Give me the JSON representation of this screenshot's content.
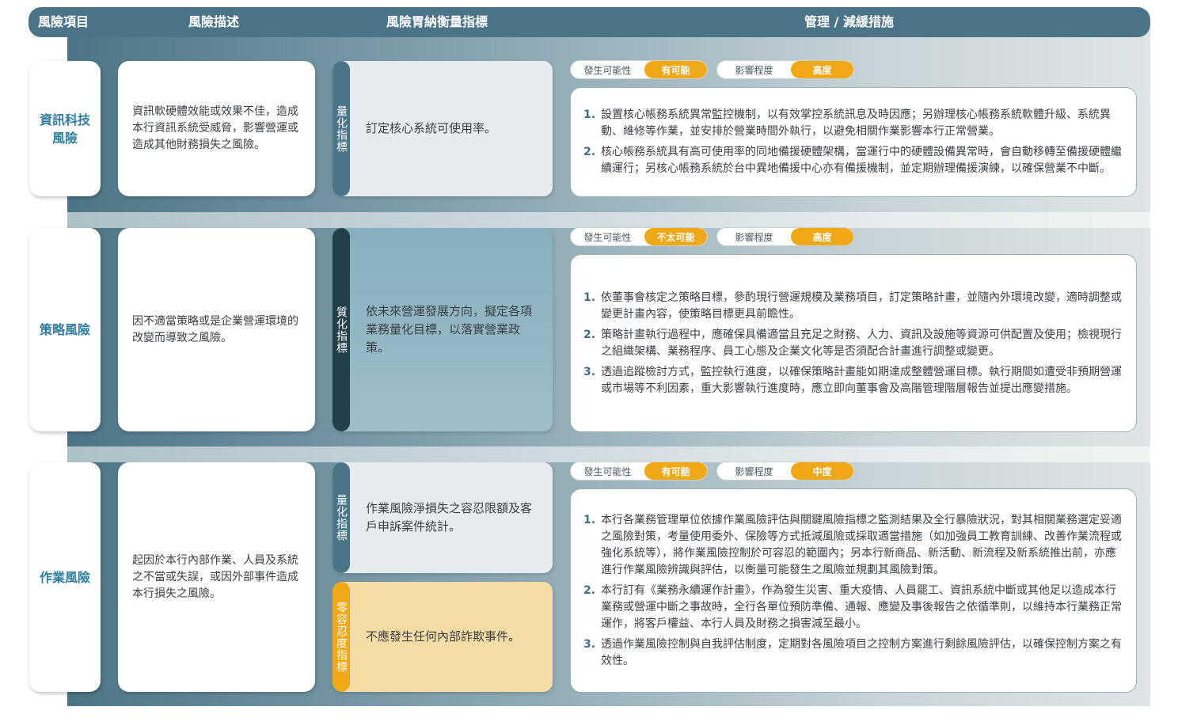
{
  "header": {
    "col1": "風險項目",
    "col2": "風險描述",
    "col3": "風險胃納衡量指標",
    "col4": "管理 / 減緩措施"
  },
  "rows": [
    {
      "category": "資訊科技\n風險",
      "description": "資訊軟硬體效能或效果不佳，造成本行資訊系統受威脅，影響營運或造成其他財務損失之風險。",
      "indicators": [
        {
          "tag": "量化指標",
          "text": "訂定核心系統可使用率。"
        }
      ],
      "likelihood_label": "發生可能性",
      "likelihood": "有可能",
      "impact_label": "影響程度",
      "impact": "高度",
      "measures": [
        {
          "num": "1.",
          "text": "設置核心帳務系統異常監控機制，以有效掌控系統訊息及時因應；另辦理核心帳務系統軟體升級、系統異動、維修等作業，並安排於營業時間外執行，以避免相關作業影響本行正常營業。"
        },
        {
          "num": "2.",
          "text": "核心帳務系統具有高可使用率的同地備援硬體架構，當運行中的硬體設備異常時，會自動移轉至備援硬體繼續運行；另核心帳務系統於台中異地備援中心亦有備援機制，並定期辦理備援演練，以確保營業不中斷。"
        }
      ]
    },
    {
      "category": "策略風險",
      "description": "因不適當策略或是企業營運環境的改變而導致之風險。",
      "indicators": [
        {
          "tag": "質化指標",
          "text": "依未來營運發展方向，擬定各項業務量化目標，以落實營業政策。"
        }
      ],
      "likelihood_label": "發生可能性",
      "likelihood": "不太可能",
      "impact_label": "影響程度",
      "impact": "高度",
      "measures": [
        {
          "num": "1.",
          "text": "依董事會核定之策略目標，參酌現行營運規模及業務項目，訂定策略計畫，並隨內外環境改變，適時調整或變更計畫內容，使策略目標更具前瞻性。"
        },
        {
          "num": "2.",
          "text": "策略計畫執行過程中，應確保具備適當且充足之財務、人力、資訊及設施等資源可供配置及使用；檢視現行之組織架構、業務程序、員工心態及企業文化等是否須配合計畫進行調整或變更。"
        },
        {
          "num": "3.",
          "text": "透過追蹤檢討方式，監控執行進度，以確保策略計畫能如期達成整體營運目標。執行期間如遭受非預期營運或市場等不利因素，重大影響執行進度時，應立即向董事會及高階管理階層報告並提出應變措施。"
        }
      ]
    },
    {
      "category": "作業風險",
      "description": "起因於本行內部作業、人員及系統之不當或失誤，或因外部事件造成本行損失之風險。",
      "indicators": [
        {
          "tag": "量化指標",
          "text": "作業風險淨損失之容忍限額及客戶申訴案件統計。"
        },
        {
          "tag": "零容忍度指標",
          "text": "不應發生任何內部詐欺事件。"
        }
      ],
      "likelihood_label": "發生可能性",
      "likelihood": "有可能",
      "impact_label": "影響程度",
      "impact": "中度",
      "measures": [
        {
          "num": "1.",
          "text": "本行各業務管理單位依據作業風險評估與關鍵風險指標之監測結果及全行暴險狀況，對其相關業務選定妥適之風險對策，考量使用委外、保險等方式抵減風險或採取適當措施（如加強員工教育訓練、改善作業流程或強化系統等），將作業風險控制於可容忍的範圍內；另本行新商品、新活動、新流程及新系統推出前，亦應進行作業風險辨識與評估，以衡量可能發生之風險並規劃其風險對策。"
        },
        {
          "num": "2.",
          "text": "本行訂有《業務永續運作計畫》，作為發生災害、重大疫情、人員罷工、資訊系統中斷或其他足以造成本行業務或營運中斷之事故時，全行各單位預防準備、通報、應變及事後報告之依循準則，以維持本行業務正常運作，將客戶權益、本行人員及財務之損害減至最小。"
        },
        {
          "num": "3.",
          "text": "透過作業風險控制與自我評估制度，定期對各風險項目之控制方案進行剩餘風險評估，以確保控制方案之有效性。"
        }
      ]
    }
  ]
}
